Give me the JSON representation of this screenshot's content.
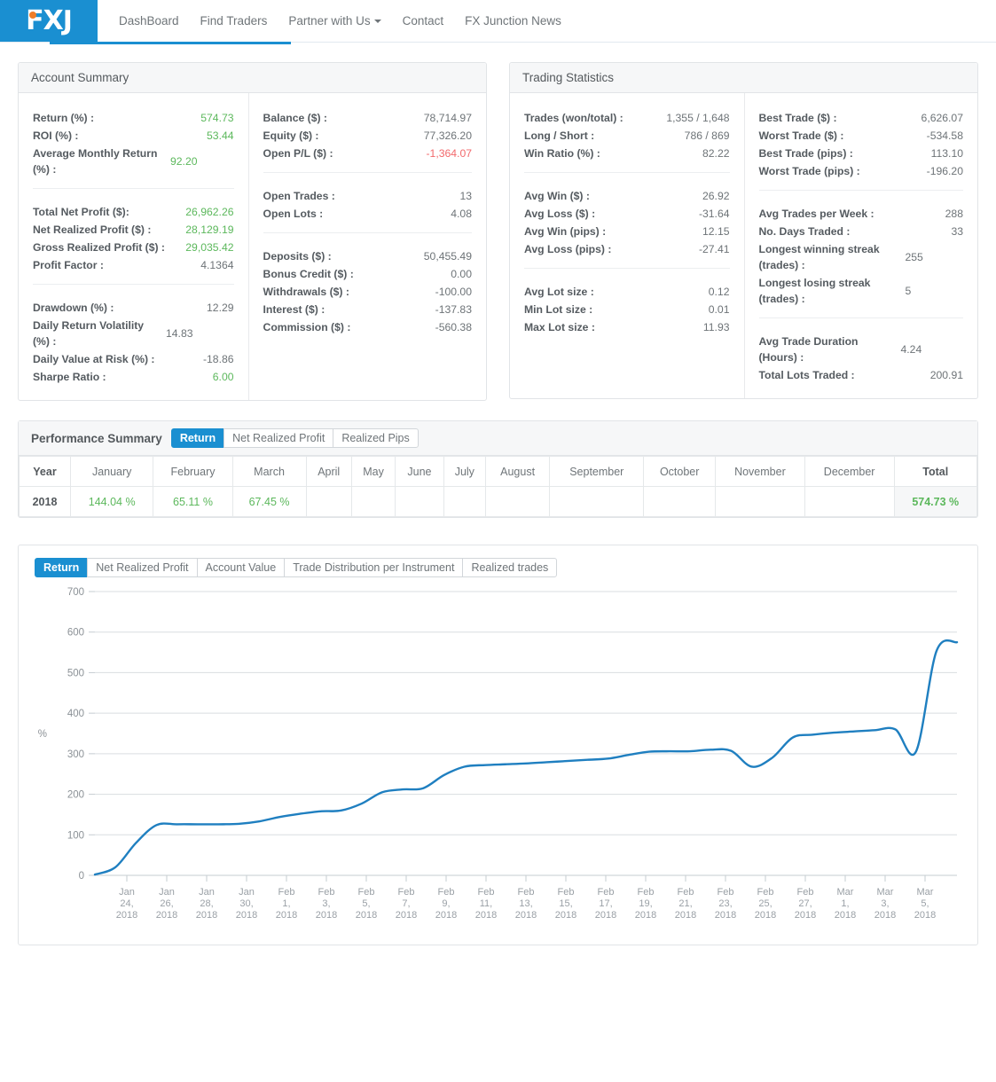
{
  "nav": {
    "brand": "FXJ",
    "links": [
      {
        "label": "DashBoard",
        "dropdown": false
      },
      {
        "label": "Find Traders",
        "dropdown": false
      },
      {
        "label": "Partner with Us",
        "dropdown": true
      },
      {
        "label": "Contact",
        "dropdown": false
      },
      {
        "label": "FX Junction News",
        "dropdown": false
      }
    ]
  },
  "account_summary": {
    "title": "Account Summary",
    "col1": [
      [
        {
          "label": "Return (%) :",
          "value": "574.73",
          "tone": "green"
        },
        {
          "label": "ROI (%) :",
          "value": "53.44",
          "tone": "green"
        },
        {
          "label": "Average Monthly Return (%) :",
          "value": "92.20",
          "tone": "green"
        }
      ],
      [
        {
          "label": "Total Net Profit ($):",
          "value": "26,962.26",
          "tone": "green"
        },
        {
          "label": "Net Realized Profit ($) :",
          "value": "28,129.19",
          "tone": "green"
        },
        {
          "label": "Gross Realized Profit ($) :",
          "value": "29,035.42",
          "tone": "green"
        },
        {
          "label": "Profit Factor :",
          "value": "4.1364",
          "tone": "plain"
        }
      ],
      [
        {
          "label": "Drawdown (%) :",
          "value": "12.29",
          "tone": "plain"
        },
        {
          "label": "Daily Return Volatility (%) :",
          "value": "14.83",
          "tone": "plain"
        },
        {
          "label": "Daily Value at Risk (%) :",
          "value": "-18.86",
          "tone": "plain"
        },
        {
          "label": "Sharpe Ratio :",
          "value": "6.00",
          "tone": "green"
        }
      ]
    ],
    "col2": [
      [
        {
          "label": "Balance ($) :",
          "value": "78,714.97",
          "tone": "plain"
        },
        {
          "label": "Equity ($) :",
          "value": "77,326.20",
          "tone": "plain"
        },
        {
          "label": "Open P/L ($) :",
          "value": "-1,364.07",
          "tone": "red"
        }
      ],
      [
        {
          "label": "Open Trades :",
          "value": "13",
          "tone": "plain"
        },
        {
          "label": "Open Lots :",
          "value": "4.08",
          "tone": "plain"
        }
      ],
      [
        {
          "label": "Deposits ($) :",
          "value": "50,455.49",
          "tone": "plain"
        },
        {
          "label": "Bonus Credit ($) :",
          "value": "0.00",
          "tone": "plain"
        },
        {
          "label": "Withdrawals ($) :",
          "value": "-100.00",
          "tone": "plain"
        },
        {
          "label": "Interest ($) :",
          "value": "-137.83",
          "tone": "plain"
        },
        {
          "label": "Commission ($) :",
          "value": "-560.38",
          "tone": "plain"
        }
      ]
    ]
  },
  "trading_statistics": {
    "title": "Trading Statistics",
    "col1": [
      [
        {
          "label": "Trades (won/total) :",
          "value": "1,355 / 1,648",
          "tone": "plain"
        },
        {
          "label": "Long / Short :",
          "value": "786 / 869",
          "tone": "plain"
        },
        {
          "label": "Win Ratio (%) :",
          "value": "82.22",
          "tone": "plain"
        }
      ],
      [
        {
          "label": "Avg Win ($) :",
          "value": "26.92",
          "tone": "plain"
        },
        {
          "label": "Avg Loss ($) :",
          "value": "-31.64",
          "tone": "plain"
        },
        {
          "label": "Avg Win (pips) :",
          "value": "12.15",
          "tone": "plain"
        },
        {
          "label": "Avg Loss (pips) :",
          "value": "-27.41",
          "tone": "plain"
        }
      ],
      [
        {
          "label": "Avg Lot size :",
          "value": "0.12",
          "tone": "plain"
        },
        {
          "label": "Min Lot size :",
          "value": "0.01",
          "tone": "plain"
        },
        {
          "label": "Max Lot size :",
          "value": "11.93",
          "tone": "plain"
        }
      ]
    ],
    "col2": [
      [
        {
          "label": "Best Trade ($) :",
          "value": "6,626.07",
          "tone": "plain"
        },
        {
          "label": "Worst Trade ($) :",
          "value": "-534.58",
          "tone": "plain"
        },
        {
          "label": "Best Trade (pips) :",
          "value": "113.10",
          "tone": "plain"
        },
        {
          "label": "Worst Trade (pips) :",
          "value": "-196.20",
          "tone": "plain"
        }
      ],
      [
        {
          "label": "Avg Trades per Week :",
          "value": "288",
          "tone": "plain"
        },
        {
          "label": "No. Days Traded :",
          "value": "33",
          "tone": "plain"
        },
        {
          "label": "Longest winning streak (trades) :",
          "value": "255",
          "tone": "plain"
        },
        {
          "label": "Longest losing streak (trades) :",
          "value": "5",
          "tone": "plain"
        }
      ],
      [
        {
          "label": "Avg Trade Duration (Hours) :",
          "value": "4.24",
          "tone": "plain"
        },
        {
          "label": "Total Lots Traded :",
          "value": "200.91",
          "tone": "plain"
        }
      ]
    ]
  },
  "performance_summary": {
    "title": "Performance Summary",
    "tabs": [
      {
        "label": "Return",
        "active": true
      },
      {
        "label": "Net Realized Profit",
        "active": false
      },
      {
        "label": "Realized Pips",
        "active": false
      }
    ],
    "columns": [
      "Year",
      "January",
      "February",
      "March",
      "April",
      "May",
      "June",
      "July",
      "August",
      "September",
      "October",
      "November",
      "December",
      "Total"
    ],
    "rows": [
      {
        "year": "2018",
        "values": [
          "144.04 %",
          "65.11 %",
          "67.45 %",
          "",
          "",
          "",
          "",
          "",
          "",
          "",
          "",
          ""
        ],
        "total": "574.73 %"
      }
    ]
  },
  "chart_section": {
    "tabs": [
      {
        "label": "Return",
        "active": true
      },
      {
        "label": "Net Realized Profit",
        "active": false
      },
      {
        "label": "Account Value",
        "active": false
      },
      {
        "label": "Trade Distribution per Instrument",
        "active": false
      },
      {
        "label": "Realized trades",
        "active": false
      }
    ]
  },
  "chart_data": {
    "type": "line",
    "title": "",
    "xlabel": "",
    "ylabel": "%",
    "ylim": [
      0,
      700
    ],
    "yticks": [
      0,
      100,
      200,
      300,
      400,
      500,
      600,
      700
    ],
    "grid": true,
    "legend": false,
    "line_color": "#1f7fc0",
    "xticks": [
      "Jan 24, 2018",
      "Jan 26, 2018",
      "Jan 28, 2018",
      "Jan 30, 2018",
      "Feb 1, 2018",
      "Feb 3, 2018",
      "Feb 5, 2018",
      "Feb 7, 2018",
      "Feb 9, 2018",
      "Feb 11, 2018",
      "Feb 13, 2018",
      "Feb 15, 2018",
      "Feb 17, 2018",
      "Feb 19, 2018",
      "Feb 21, 2018",
      "Feb 23, 2018",
      "Feb 25, 2018",
      "Feb 27, 2018",
      "Mar 1, 2018",
      "Mar 3, 2018",
      "Mar 5, 2018"
    ],
    "series": [
      {
        "name": "Return",
        "x": [
          "Jan 23, 2018",
          "Jan 24, 2018",
          "Jan 25, 2018",
          "Jan 26, 2018",
          "Jan 27, 2018",
          "Jan 28, 2018",
          "Jan 29, 2018",
          "Jan 30, 2018",
          "Jan 31, 2018",
          "Feb 1, 2018",
          "Feb 2, 2018",
          "Feb 3, 2018",
          "Feb 4, 2018",
          "Feb 5, 2018",
          "Feb 6, 2018",
          "Feb 7, 2018",
          "Feb 8, 2018",
          "Feb 9, 2018",
          "Feb 10, 2018",
          "Feb 11, 2018",
          "Feb 12, 2018",
          "Feb 13, 2018",
          "Feb 14, 2018",
          "Feb 15, 2018",
          "Feb 16, 2018",
          "Feb 17, 2018",
          "Feb 18, 2018",
          "Feb 19, 2018",
          "Feb 20, 2018",
          "Feb 21, 2018",
          "Feb 22, 2018",
          "Feb 23, 2018",
          "Feb 24, 2018",
          "Feb 25, 2018",
          "Feb 26, 2018",
          "Feb 27, 2018",
          "Feb 28, 2018",
          "Mar 1, 2018",
          "Mar 2, 2018",
          "Mar 3, 2018",
          "Mar 4, 2018",
          "Mar 5, 2018",
          "Mar 6, 2018"
        ],
        "values": [
          2,
          20,
          80,
          124,
          126,
          126,
          126,
          127,
          133,
          144,
          152,
          158,
          160,
          177,
          205,
          212,
          215,
          247,
          268,
          272,
          274,
          276,
          279,
          282,
          285,
          288,
          297,
          305,
          306,
          306,
          310,
          307,
          268,
          290,
          340,
          347,
          352,
          355,
          358,
          360,
          305,
          553,
          575
        ]
      }
    ]
  }
}
